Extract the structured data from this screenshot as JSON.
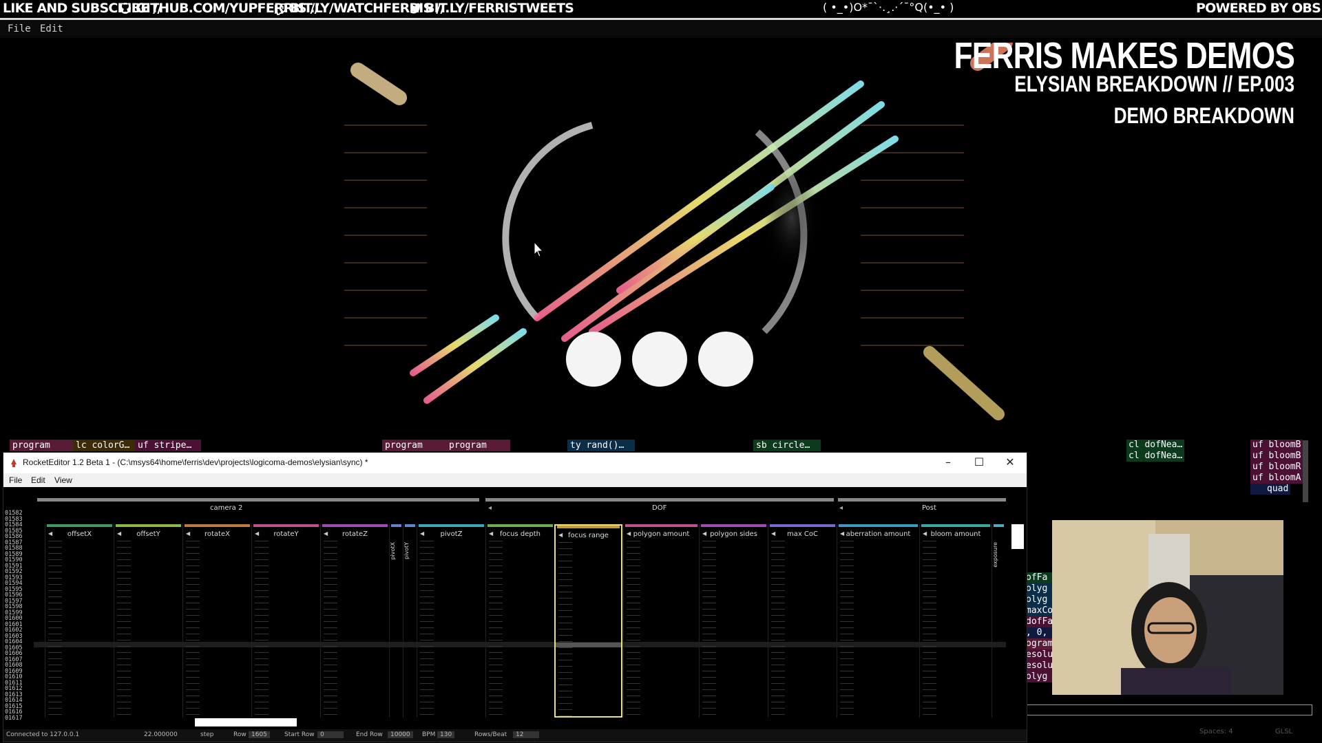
{
  "banner": {
    "left_text": "LIKE AND SUBSCRIBE //",
    "github": "GITHUB.COM/YUPFERRIS //",
    "twitch": "BIT.LY/WATCHFERRIS //",
    "twitter": "BIT.LY/FERRISTWEETS",
    "center_text": "( •_•)O*¯`·.¸.·´¯°Q(•_• )",
    "right_text": "POWERED BY OBS"
  },
  "app_menu": {
    "file": "File",
    "edit": "Edit"
  },
  "overlay": {
    "title": "FERRIS MAKES DEMOS",
    "subtitle": "ELYSIAN BREAKDOWN // EP.003",
    "section": "DEMO BREAKDOWN"
  },
  "shader_tags": [
    {
      "label": "program",
      "color": "#5a1b37"
    },
    {
      "label": "lc colorG…",
      "color": "#3d2a06"
    },
    {
      "label": "uf stripe…",
      "color": "#4c1035"
    },
    {
      "label": "program",
      "color": "#5a1b37"
    },
    {
      "label": "program",
      "color": "#5a1b37"
    },
    {
      "label": "ty rand()…",
      "color": "#0a2d4a"
    },
    {
      "label": "sb circle…",
      "color": "#0c3a1c"
    }
  ],
  "rocket": {
    "title": "RocketEditor 1.2 Beta 1 - (C:\\msys64\\home\\ferris\\dev\\projects\\logicoma-demos\\elysian\\sync) *",
    "menu": {
      "file": "File",
      "edit": "Edit",
      "view": "View"
    },
    "groups": [
      {
        "label": "camera 2"
      },
      {
        "label": "DOF"
      },
      {
        "label": "Post"
      }
    ],
    "columns": [
      {
        "label": "offsetX",
        "color": "#3f9a5e"
      },
      {
        "label": "offsetY",
        "color": "#8fb84a"
      },
      {
        "label": "rotateX",
        "color": "#c07a3c"
      },
      {
        "label": "rotateY",
        "color": "#c0508a"
      },
      {
        "label": "rotateZ",
        "color": "#a04ab5"
      },
      {
        "label": "pivotX",
        "color": "#6a7bd0"
      },
      {
        "label": "pivotY",
        "color": "#5a8bd0"
      },
      {
        "label": "pivotZ",
        "color": "#3aa6b8"
      },
      {
        "label": "focus depth",
        "color": "#6ab04a"
      },
      {
        "label": "focus range",
        "color": "#c99a3a"
      },
      {
        "label": "polygon amount",
        "color": "#c0508a"
      },
      {
        "label": "polygon sides",
        "color": "#a04ab5"
      },
      {
        "label": "max CoC",
        "color": "#7a6ad0"
      },
      {
        "label": "aberration amount",
        "color": "#3a9ac0"
      },
      {
        "label": "bloom amount",
        "color": "#3aa6a0"
      },
      {
        "label": "exposure",
        "color": "#4ab0c0"
      }
    ],
    "row_numbers": [
      "01582",
      "01583",
      "01584",
      "01585",
      "01586",
      "01587",
      "01588",
      "01589",
      "01590",
      "01591",
      "01592",
      "01593",
      "01594",
      "01595",
      "01596",
      "01597",
      "01598",
      "01599",
      "01600",
      "01601",
      "01602",
      "01603",
      "01604",
      "01605",
      "01606",
      "01607",
      "01608",
      "01609",
      "01610",
      "01611",
      "01612",
      "01613",
      "01614",
      "01615",
      "01616",
      "01617"
    ],
    "status": {
      "connection": "Connected to 127.0.0.1",
      "value": "22.000000",
      "step": "step",
      "row_label": "Row",
      "row": "1605",
      "start_label": "Start Row",
      "start": "0",
      "end_label": "End Row",
      "end": "10000",
      "bpm_label": "BPM",
      "bpm": "130",
      "rpb_label": "Rows/Beat",
      "rpb": "12"
    },
    "window_controls": {
      "minimize": "–",
      "maximize": "☐",
      "close": "✕"
    }
  },
  "right_code": {
    "green_tags": [
      "cl dofNea…",
      "cl dofNea…"
    ],
    "red_tags": [
      "uf bloomB",
      "uf bloomB",
      "uf bloomR",
      "uf bloomA"
    ],
    "quad": "quad",
    "snippet_lines": [
      "ofFa",
      "olyg",
      "olyg",
      "maxCo",
      "dofFa",
      ", 0,",
      "ogram",
      "esolu",
      "esolu",
      "olyg"
    ],
    "footer_spaces": "Spaces: 4",
    "footer_lang": "GLSL"
  },
  "icons": [
    "github-icon",
    "twitch-icon",
    "twitter-icon",
    "rocket-app-icon",
    "mouse-cursor-icon"
  ]
}
